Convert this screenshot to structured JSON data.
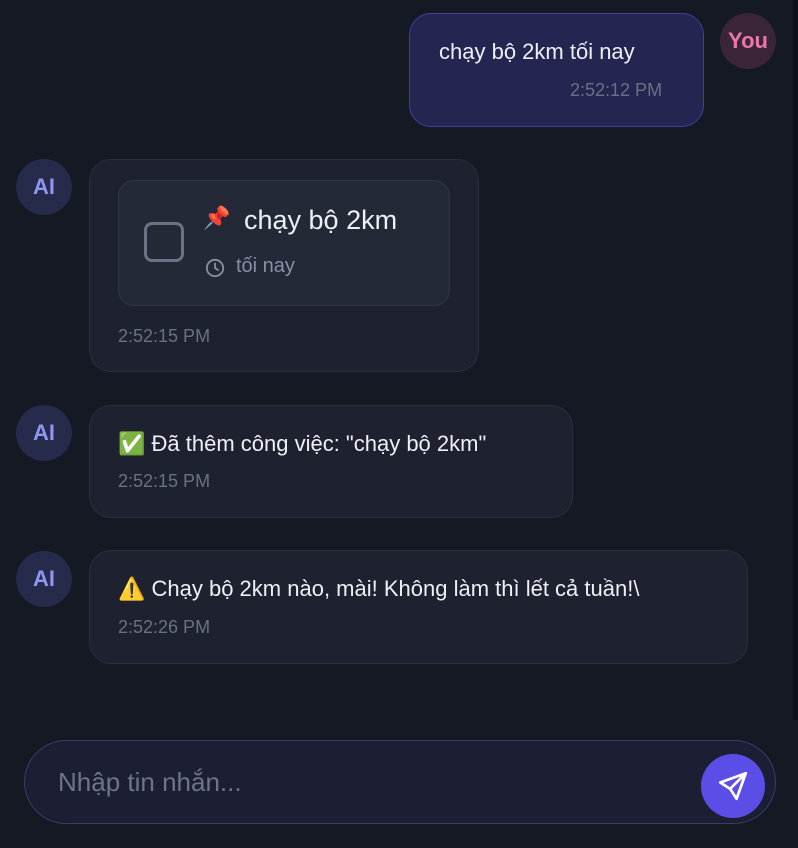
{
  "messages": [
    {
      "sender": "You",
      "text": "chạy bộ 2km tối nay",
      "time": "2:52:12 PM"
    },
    {
      "sender": "AI",
      "task": {
        "icon": "📌",
        "title": "chạy bộ 2km",
        "due": "tối nay"
      },
      "time": "2:52:15 PM"
    },
    {
      "sender": "AI",
      "text": "✅ Đã thêm công việc: \"chạy bộ 2km\"",
      "time": "2:52:15 PM"
    },
    {
      "sender": "AI",
      "text": "⚠️ Chạy bộ 2km nào, mài!  Không làm thì lết cả tuần!\\",
      "time": "2:52:26 PM"
    }
  ],
  "composer": {
    "placeholder": "Nhập tin nhắn..."
  },
  "colors": {
    "accent": "#5b4ee6",
    "user_bubble": "#242551",
    "ai_bubble": "#1d2130",
    "background": "#151923"
  },
  "icons": {
    "send": "send-icon",
    "clock": "clock-icon",
    "pin": "pin-icon"
  }
}
